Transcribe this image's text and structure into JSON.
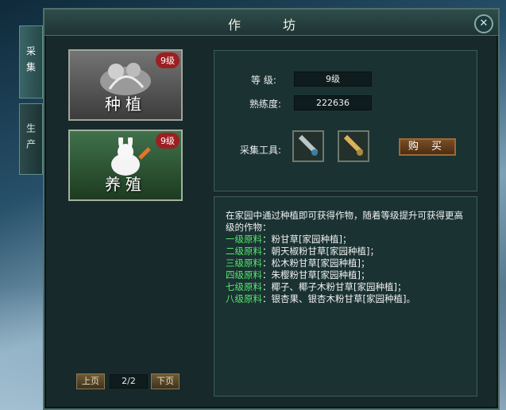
{
  "window": {
    "title": "作 坊"
  },
  "side_tabs": [
    {
      "label": "采集"
    },
    {
      "label": "生产"
    }
  ],
  "cards": [
    {
      "label": "种植",
      "level": "9级"
    },
    {
      "label": "养殖",
      "level": "9级"
    }
  ],
  "stats": {
    "level_label": "等  级:",
    "level_value": "9级",
    "proficiency_label": "熟练度:",
    "proficiency_value": "222636",
    "tools_label": "采集工具:",
    "buy_label": "购 买"
  },
  "description": {
    "intro": "在家园中通过种植即可获得作物，随着等级提升可获得更高级的作物：",
    "lines": [
      {
        "level": "一级原料",
        "items": "粉甘草[家园种植]；"
      },
      {
        "level": "二级原料",
        "items": "朝天椒粉甘草[家园种植]；"
      },
      {
        "level": "三级原料",
        "items": "松木粉甘草[家园种植]；"
      },
      {
        "level": "四级原料",
        "items": "朱樱粉甘草[家园种植]；"
      },
      {
        "level": "七级原料",
        "items": "椰子、椰子木粉甘草[家园种植]；"
      },
      {
        "level": "八级原料",
        "items": "银杏果、银杏木粉甘草[家园种植]。"
      }
    ]
  },
  "pager": {
    "prev": "上页",
    "page": "2/2",
    "next": "下页"
  },
  "colors": {
    "level_text": "#55e86b",
    "panel": "#1a3232"
  }
}
